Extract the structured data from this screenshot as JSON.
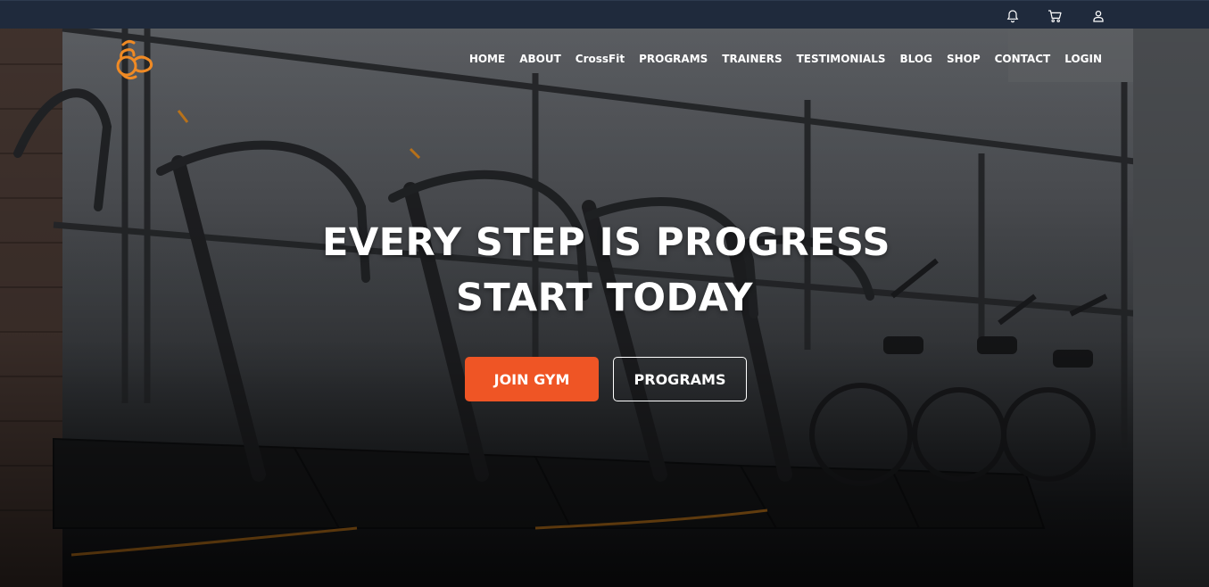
{
  "topbar": {
    "icons": [
      "bell-icon",
      "cart-icon",
      "user-icon"
    ]
  },
  "brand": {
    "logo": "gym-logo",
    "accent": "#f08a24"
  },
  "nav": {
    "items": [
      {
        "label": "HOME"
      },
      {
        "label": "ABOUT"
      },
      {
        "label": "CrossFit"
      },
      {
        "label": "PROGRAMS"
      },
      {
        "label": "TRAINERS"
      },
      {
        "label": "TESTIMONIALS"
      },
      {
        "label": "BLOG"
      },
      {
        "label": "SHOP"
      },
      {
        "label": "CONTACT"
      },
      {
        "label": "LOGIN"
      }
    ]
  },
  "hero": {
    "headline_line1": "EVERY STEP IS PROGRESS",
    "headline_line2": "START TODAY",
    "primary_button": "JOIN GYM",
    "secondary_button": "PROGRAMS",
    "primary_color": "#ef5525"
  }
}
